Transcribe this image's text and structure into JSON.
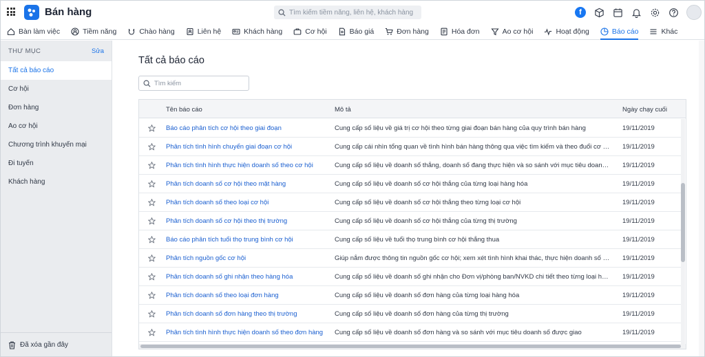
{
  "app": {
    "title": "Bán hàng"
  },
  "search": {
    "placeholder": "Tìm kiếm tiềm năng, liên hệ, khách hàng"
  },
  "nav": {
    "tabs": [
      {
        "label": "Bàn làm việc",
        "icon": "home-icon"
      },
      {
        "label": "Tiềm năng",
        "icon": "user-circle-icon"
      },
      {
        "label": "Chào hàng",
        "icon": "magnet-icon"
      },
      {
        "label": "Liên hệ",
        "icon": "contact-card-icon"
      },
      {
        "label": "Khách hàng",
        "icon": "customer-card-icon"
      },
      {
        "label": "Cơ hội",
        "icon": "briefcase-icon"
      },
      {
        "label": "Báo giá",
        "icon": "quote-doc-icon"
      },
      {
        "label": "Đơn hàng",
        "icon": "cart-icon"
      },
      {
        "label": "Hóa đơn",
        "icon": "invoice-icon"
      },
      {
        "label": "Ao cơ hội",
        "icon": "funnel-icon"
      },
      {
        "label": "Hoạt động",
        "icon": "activity-icon"
      },
      {
        "label": "Báo cáo",
        "icon": "pie-chart-icon"
      },
      {
        "label": "Khác",
        "icon": "menu-icon"
      }
    ],
    "active_index": 11
  },
  "sidebar": {
    "heading": "THƯ MỤC",
    "edit_label": "Sửa",
    "items": [
      {
        "label": "Tất cả báo cáo"
      },
      {
        "label": "Cơ hội"
      },
      {
        "label": "Đơn hàng"
      },
      {
        "label": "Ao cơ hội"
      },
      {
        "label": "Chương trình khuyến mại"
      },
      {
        "label": "Đi tuyến"
      },
      {
        "label": "Khách hàng"
      }
    ],
    "active_index": 0,
    "recent_deleted": "Đã xóa gần đây"
  },
  "main": {
    "title": "Tất cả báo cáo",
    "search_placeholder": "Tìm kiếm",
    "table": {
      "columns": {
        "name": "Tên báo cáo",
        "desc": "Mô tả",
        "date": "Ngày chạy cuối"
      },
      "rows": [
        {
          "name": "Báo cáo phân tích cơ hội theo giai đoạn",
          "desc": "Cung cấp số liệu về giá trị cơ hội theo từng giai đoạn bán hàng của quy trình bán hàng",
          "date": "19/11/2019"
        },
        {
          "name": "Phân tích tình hình chuyển giai đoạn cơ hội",
          "desc": "Cung cấp cái nhìn tổng quan về tình hình bán hàng thông qua việc tìm kiếm và theo đuổi cơ hội",
          "date": "19/11/2019"
        },
        {
          "name": "Phân tích tình hình thực hiện doanh số theo cơ hội",
          "desc": "Cung cấp số liệu về doanh số thắng, doanh số đang thực hiện và so sánh với mục tiêu doanh số được giao",
          "date": "19/11/2019"
        },
        {
          "name": "Phân tích doanh số cơ hội theo mặt hàng",
          "desc": "Cung cấp số liệu về doanh số cơ hội thắng của từng loại hàng hóa",
          "date": "19/11/2019"
        },
        {
          "name": "Phân tích doanh số theo loại cơ hội",
          "desc": "Cung cấp số liệu về doanh số cơ hội thắng theo từng loại cơ hội",
          "date": "19/11/2019"
        },
        {
          "name": "Phân tích doanh số cơ hội theo thị trường",
          "desc": "Cung cấp số liệu về doanh số cơ hội thắng của từng thị trường",
          "date": "19/11/2019"
        },
        {
          "name": "Báo cáo phân tích tuổi thọ trung bình cơ hội",
          "desc": "Cung cấp số liệu về tuổi thọ trung bình cơ hội thắng thua",
          "date": "19/11/2019"
        },
        {
          "name": "Phân tích nguồn gốc cơ hội",
          "desc": "Giúp nắm được thông tin nguồn gốc cơ hội; xem xét tình hình khai thác, thực hiện doanh số từ nhiều nguồn",
          "date": "19/11/2019"
        },
        {
          "name": "Phân tích doanh số ghi nhận theo hàng hóa",
          "desc": "Cung cấp số liệu về doanh số ghi nhận cho Đơn vị/phòng ban/NVKD chi tiết theo từng loại hàng hóa",
          "date": "19/11/2019"
        },
        {
          "name": "Phân tích doanh số theo loại đơn hàng",
          "desc": "Cung cấp số liệu về doanh số đơn hàng của từng loại hàng hóa",
          "date": "19/11/2019"
        },
        {
          "name": "Phân tích doanh số đơn hàng theo thị trường",
          "desc": "Cung cấp số liệu về doanh số đơn hàng của từng thị trường",
          "date": "19/11/2019"
        },
        {
          "name": "Phân tích tình hình thực hiện doanh số theo đơn hàng",
          "desc": "Cung cấp số liệu về doanh số đơn hàng và so sánh với mục tiêu doanh số được giao",
          "date": "19/11/2019"
        }
      ]
    }
  }
}
